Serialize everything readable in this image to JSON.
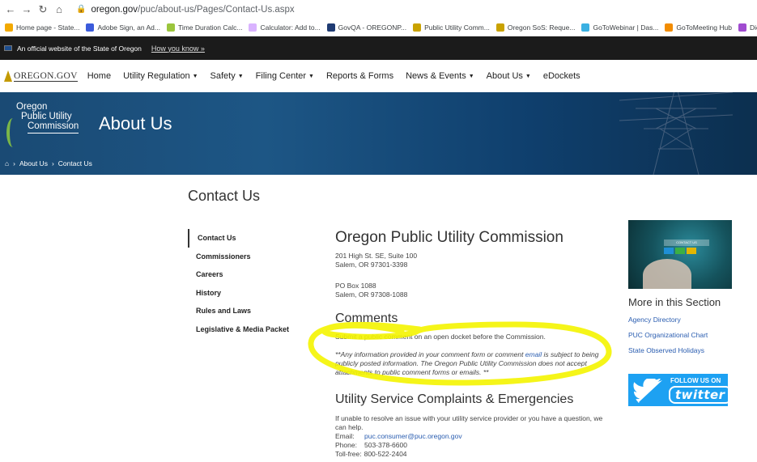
{
  "browser": {
    "url_host": "oregon.gov",
    "url_path": "/puc/about-us/Pages/Contact-Us.aspx",
    "bookmarks": [
      {
        "label": "Home page - State...",
        "color": "#f2a900"
      },
      {
        "label": "Adobe Sign, an Ad...",
        "color": "#3b5bdb"
      },
      {
        "label": "Time Duration Calc...",
        "color": "#9bc53d"
      },
      {
        "label": "Calculator: Add to...",
        "color": "#d9b3ff"
      },
      {
        "label": "GovQA - OREGONP...",
        "color": "#1f3b73"
      },
      {
        "label": "Public Utility Comm...",
        "color": "#c9a200"
      },
      {
        "label": "Oregon SoS: Reque...",
        "color": "#c9a200"
      },
      {
        "label": "GoToWebinar | Das...",
        "color": "#3ab0e2"
      },
      {
        "label": "GoToMeeting Hub",
        "color": "#f28c00"
      },
      {
        "label": "Dictionary Merriam...",
        "color": "#a04bd0"
      }
    ]
  },
  "banner": {
    "text": "An official website of the State of Oregon",
    "how_link": "How you know »"
  },
  "nav": {
    "logo": "OREGON.GOV",
    "items": [
      {
        "label": "Home",
        "dropdown": false
      },
      {
        "label": "Utility Regulation",
        "dropdown": true
      },
      {
        "label": "Safety",
        "dropdown": true
      },
      {
        "label": "Filing Center",
        "dropdown": true
      },
      {
        "label": "Reports & Forms",
        "dropdown": false
      },
      {
        "label": "News & Events",
        "dropdown": true
      },
      {
        "label": "About Us",
        "dropdown": true
      },
      {
        "label": "eDockets",
        "dropdown": false
      }
    ]
  },
  "hero": {
    "logo_line1": "Oregon",
    "logo_line2": "Public Utility",
    "logo_line3": "Commission",
    "title": "About Us",
    "breadcrumb": [
      "About Us",
      "Contact Us"
    ]
  },
  "page": {
    "title": "Contact Us",
    "side_nav": [
      "Contact Us",
      "Commissioners",
      "Careers",
      "History",
      "Rules and Laws",
      "Legislative & Media Packet"
    ],
    "active_index": 0
  },
  "main": {
    "org_heading": "Oregon Public Utility Commission",
    "street1": "201 High St. SE, Suite 100",
    "street2": "Salem, OR 97301-3398",
    "po1": "PO Box 1088",
    "po2": "Salem, OR 97308-1088",
    "comments_heading": "Comments",
    "comment_pre": "Submit a public comment ",
    "comment_link": "on an open docket",
    "comment_post": " before the Commission.",
    "note_pre": "**Any information provided in your comment form or comment ",
    "note_link": "email",
    "note_post": " is subject to being publicly posted information. The Oregon Public Utility Commission does not accept attachments to public comment forms or emails. **",
    "util_heading": "Utility Service Complaints & Emergencies",
    "util_intro": "If unable to resolve an issue with your utility service provider or you have a question, we can help.",
    "email_label": "Email:",
    "email_value": "puc.consumer@puc.oregon.gov",
    "phone_label": "Phone:",
    "phone_value": "503-378-6600",
    "tollfree_label": "Toll-free:",
    "tollfree_value": "800-522-2404"
  },
  "aside": {
    "thumb_label": "CONTACT US",
    "heading": "More in this Section",
    "links": [
      "Agency Directory",
      "PUC Organizational Chart",
      "State Observed Holidays"
    ],
    "twitter_follow": "FOLLOW US ON",
    "twitter_word": "twitter"
  },
  "colors": {
    "highlight": "#f4f400",
    "link": "#2a5db0",
    "hero_blue": "#1d5685",
    "twitter": "#1da1f2"
  }
}
